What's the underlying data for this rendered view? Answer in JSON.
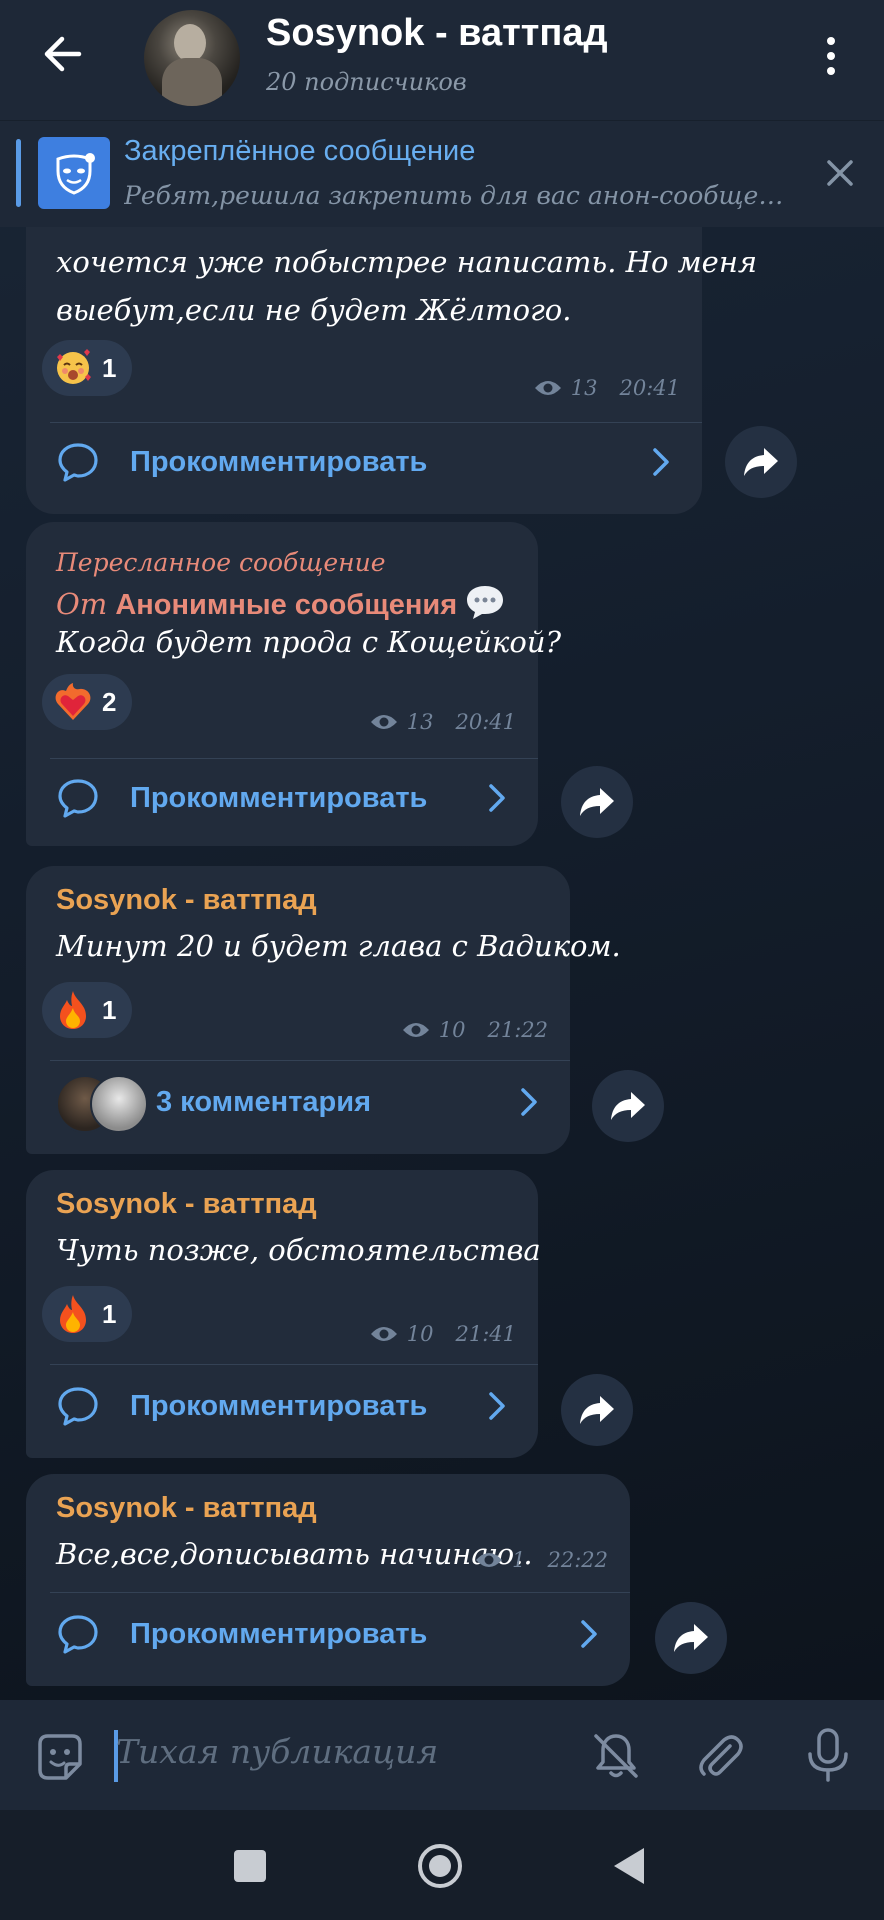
{
  "header": {
    "title": "Sosynok - ваттпад",
    "subtitle": "20 подписчиков"
  },
  "pinned": {
    "title": "Закреплённое сообщение",
    "text": "Ребят,решила закрепить для вас анон-сообщения,ч..."
  },
  "messages": [
    {
      "text_lines": [
        "хочется уже побыстрее написать. Но меня",
        "выебут,если не будет Жёлтого."
      ],
      "reaction": {
        "emoji": "smiling-face-with-hearts",
        "count": "1"
      },
      "views": "13",
      "time": "20:41",
      "comment_label": "Прокомментировать"
    },
    {
      "forwarded_label": "Пересланное сообщение",
      "forwarded_prefix": "От",
      "forwarded_from": "Анонимные сообщения",
      "text": "Когда будет прода с Кощейкой?",
      "reaction": {
        "emoji": "heart-on-fire",
        "count": "2"
      },
      "views": "13",
      "time": "20:41",
      "comment_label": "Прокомментировать"
    },
    {
      "author": "Sosynok - ваттпад",
      "text": "Минут 20 и будет глава с Вадиком.",
      "reaction": {
        "emoji": "fire",
        "count": "1"
      },
      "views": "10",
      "time": "21:22",
      "comment_label": "3 комментария"
    },
    {
      "author": "Sosynok - ваттпад",
      "text": "Чуть позже, обстоятельства",
      "reaction": {
        "emoji": "fire",
        "count": "1"
      },
      "views": "10",
      "time": "21:41",
      "comment_label": "Прокомментировать"
    },
    {
      "author": "Sosynok - ваттпад",
      "text": "Все,все,дописывать начинаю..",
      "views": "1",
      "time": "22:22",
      "comment_label": "Прокомментировать"
    }
  ],
  "input": {
    "placeholder": "Тихая публикация"
  },
  "colors": {
    "accent": "#62a9ef",
    "author": "#eaa353",
    "forwarded": "#e88a79",
    "bubble": "#222c3b"
  }
}
